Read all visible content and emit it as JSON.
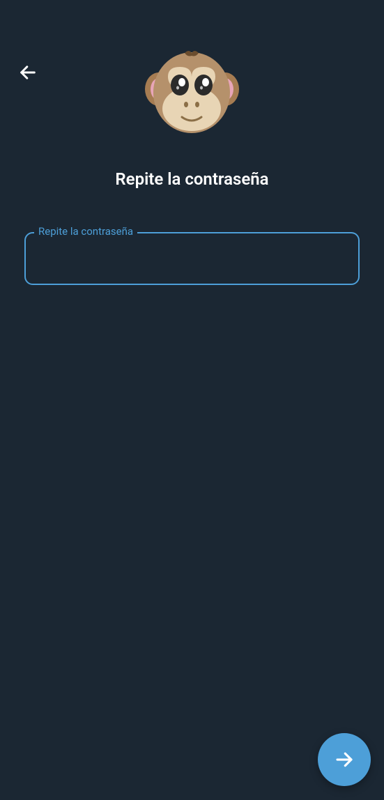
{
  "header": {
    "title": "Repite la contraseña"
  },
  "form": {
    "password_label": "Repite la contraseña",
    "password_value": ""
  },
  "icons": {
    "back": "arrow-left",
    "submit": "arrow-right",
    "mascot": "monkey"
  },
  "colors": {
    "background": "#1b2733",
    "accent": "#4d9fd8",
    "text": "#ffffff"
  }
}
